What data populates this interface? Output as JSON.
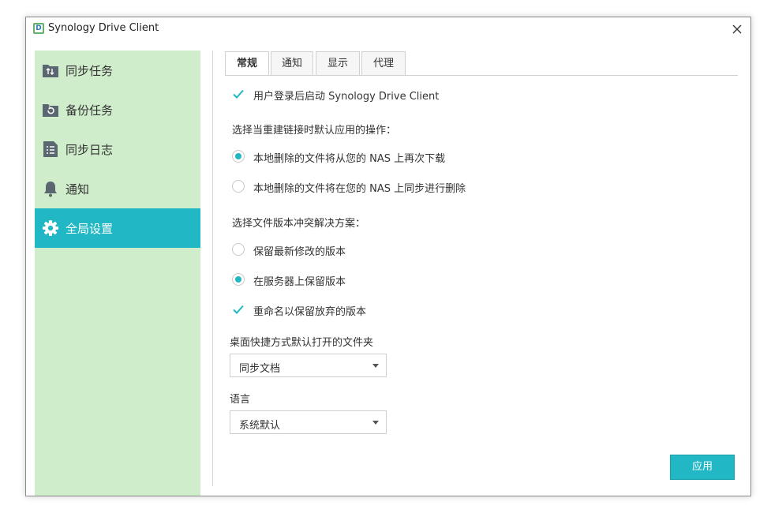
{
  "window": {
    "title": "Synology Drive Client",
    "logo_letter": "D"
  },
  "sidebar": {
    "items": [
      {
        "label": "同步任务",
        "icon": "sync-folder-icon"
      },
      {
        "label": "备份任务",
        "icon": "backup-folder-icon"
      },
      {
        "label": "同步日志",
        "icon": "log-icon"
      },
      {
        "label": "通知",
        "icon": "bell-icon"
      },
      {
        "label": "全局设置",
        "icon": "gear-icon",
        "active": true
      }
    ]
  },
  "tabs": [
    {
      "label": "常规",
      "active": true
    },
    {
      "label": "通知"
    },
    {
      "label": "显示"
    },
    {
      "label": "代理"
    }
  ],
  "general": {
    "autostart_label": "用户登录后启动 Synology Drive Client",
    "autostart_checked": true,
    "relink_heading": "选择当重建链接时默认应用的操作：",
    "relink_options": [
      {
        "label": "本地删除的文件将从您的 NAS 上再次下载",
        "selected": true
      },
      {
        "label": "本地删除的文件将在您的 NAS 上同步进行删除",
        "selected": false
      }
    ],
    "conflict_heading": "选择文件版本冲突解决方案：",
    "conflict_options": [
      {
        "label": "保留最新修改的版本",
        "selected": false
      },
      {
        "label": "在服务器上保留版本",
        "selected": true
      }
    ],
    "rename_label": "重命名以保留放弃的版本",
    "rename_checked": true,
    "shortcut_heading": "桌面快捷方式默认打开的文件夹",
    "shortcut_value": "同步文档",
    "language_heading": "语言",
    "language_value": "系统默认"
  },
  "apply_label": "应用",
  "colors": {
    "accent": "#21b7c4",
    "sidebar_bg": "#cfeccb"
  }
}
